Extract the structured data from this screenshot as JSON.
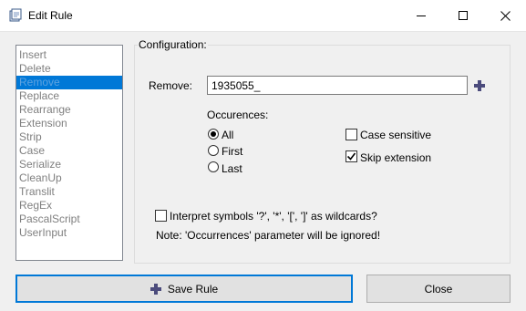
{
  "window": {
    "title": "Edit Rule",
    "icons": {
      "app": "app-icon",
      "minimize": "minimize-icon",
      "maximize": "maximize-icon",
      "close": "close-icon"
    }
  },
  "rule_list": {
    "items": [
      "Insert",
      "Delete",
      "Remove",
      "Replace",
      "Rearrange",
      "Extension",
      "Strip",
      "Case",
      "Serialize",
      "CleanUp",
      "Translit",
      "RegEx",
      "PascalScript",
      "UserInput"
    ],
    "selected_index": 2
  },
  "config": {
    "group_label": "Configuration:",
    "remove_label": "Remove:",
    "remove_value": "1935055_",
    "add_icon": "plus-icon",
    "occurrences_label": "Occurences:",
    "occurrences_options": [
      "All",
      "First",
      "Last"
    ],
    "occurrences_selected": 0,
    "case_sensitive_label": "Case sensitive",
    "case_sensitive_checked": false,
    "skip_extension_label": "Skip extension",
    "skip_extension_checked": true,
    "wildcards_label": "Interpret symbols '?', '*', '[', ']' as wildcards?",
    "wildcards_checked": false,
    "note": "Note: 'Occurrences' parameter will be ignored!"
  },
  "buttons": {
    "save_label": "Save Rule",
    "save_icon": "plus-icon",
    "close_label": "Close"
  },
  "colors": {
    "selection": "#0078d7",
    "accent_icon": "#4b4b7c"
  }
}
